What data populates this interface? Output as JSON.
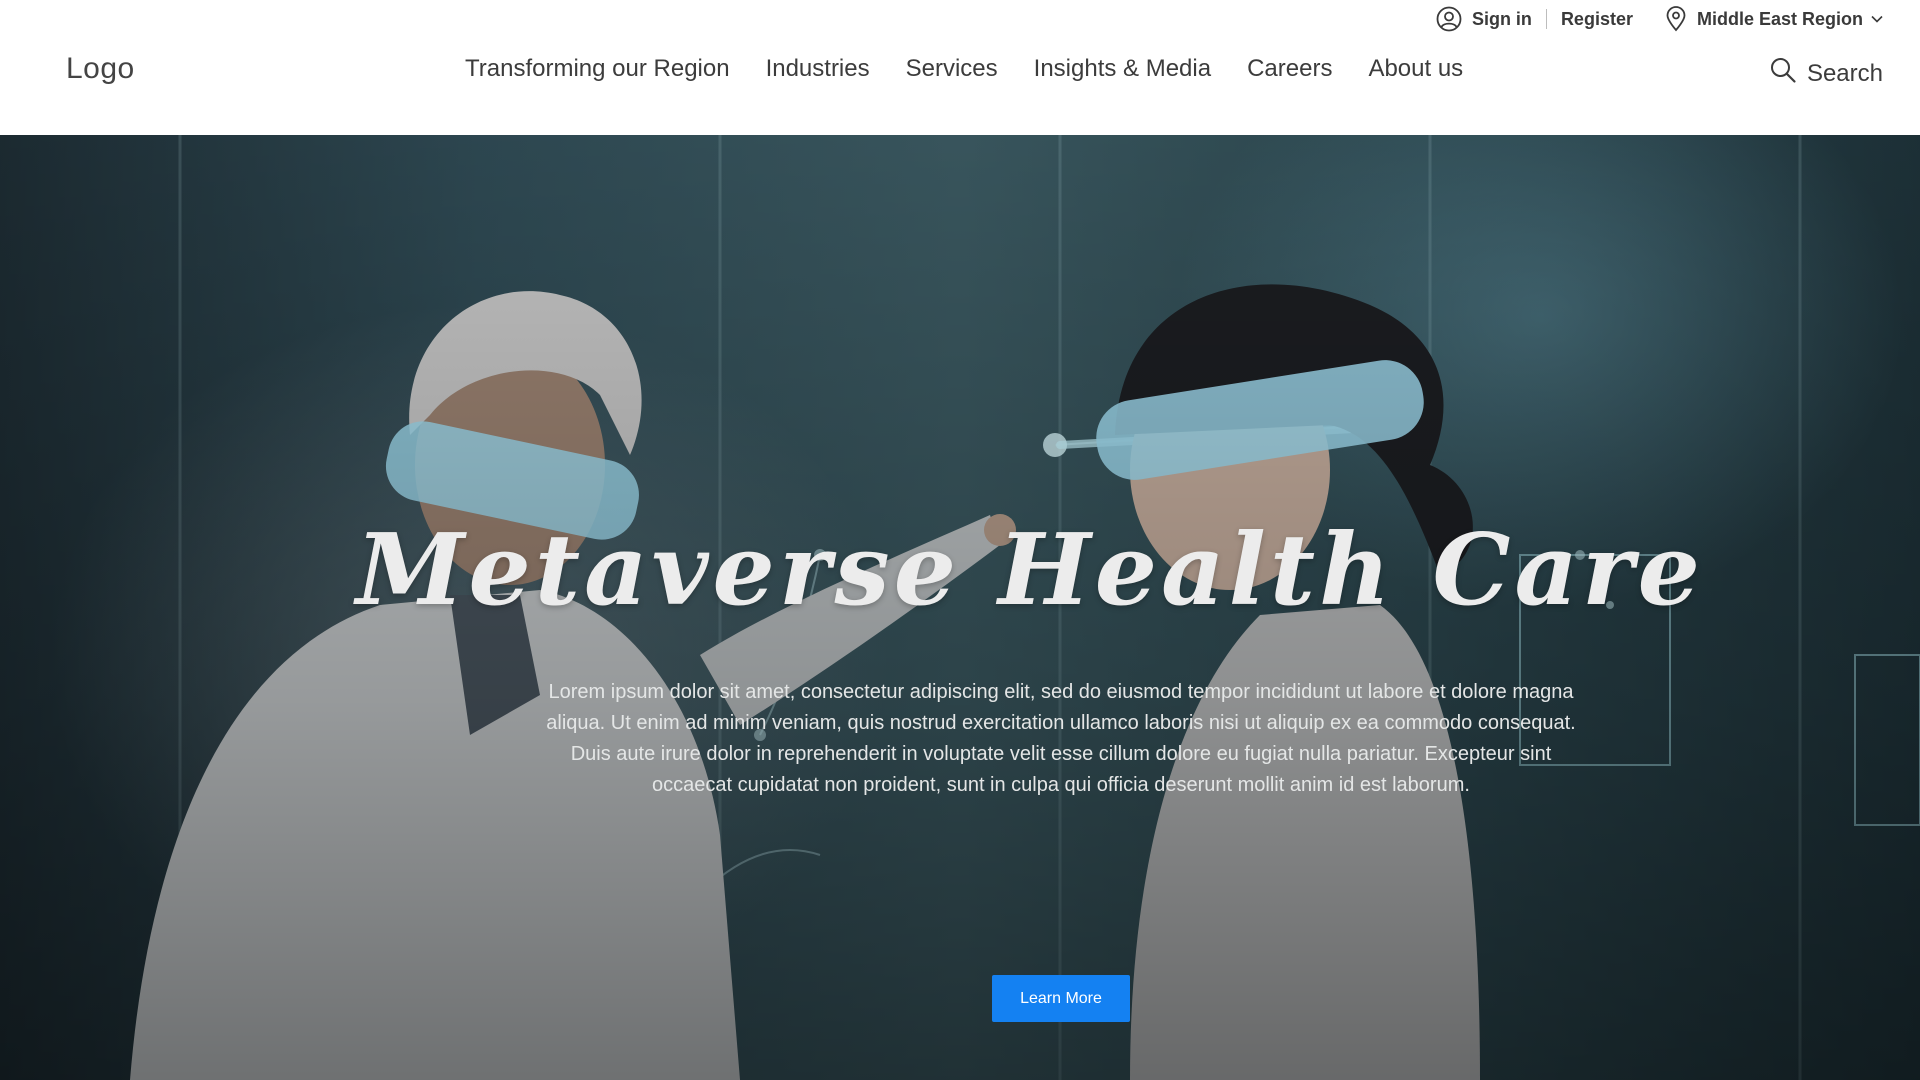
{
  "header": {
    "logo": "Logo",
    "utility": {
      "sign_in": "Sign in",
      "register": "Register",
      "region": "Middle East Region",
      "user_icon": "user-circle-icon",
      "location_icon": "map-pin-icon",
      "dropdown_icon": "chevron-down-icon"
    },
    "nav": [
      {
        "label": "Transforming our Region"
      },
      {
        "label": "Industries"
      },
      {
        "label": "Services"
      },
      {
        "label": "Insights & Media"
      },
      {
        "label": "Careers"
      },
      {
        "label": "About us"
      }
    ],
    "search": {
      "label": "Search",
      "icon": "search-icon"
    }
  },
  "hero": {
    "title": "Metaverse Health Care",
    "body": "Lorem ipsum dolor sit amet, consectetur adipiscing elit, sed do eiusmod tempor incididunt ut labore et dolore magna aliqua. Ut enim ad minim veniam, quis nostrud exercitation ullamco laboris nisi ut aliquip ex ea commodo consequat. Duis aute irure dolor in reprehenderit in voluptate velit esse cillum dolore eu fugiat nulla pariatur. Excepteur sint occaecat cupidatat non proident, sunt in culpa qui officia deserunt mollit anim id est laborum.",
    "cta": "Learn More"
  },
  "colors": {
    "button": "#1481f2",
    "header_bg": "#ffffff",
    "nav_text": "#3c3c3c"
  }
}
